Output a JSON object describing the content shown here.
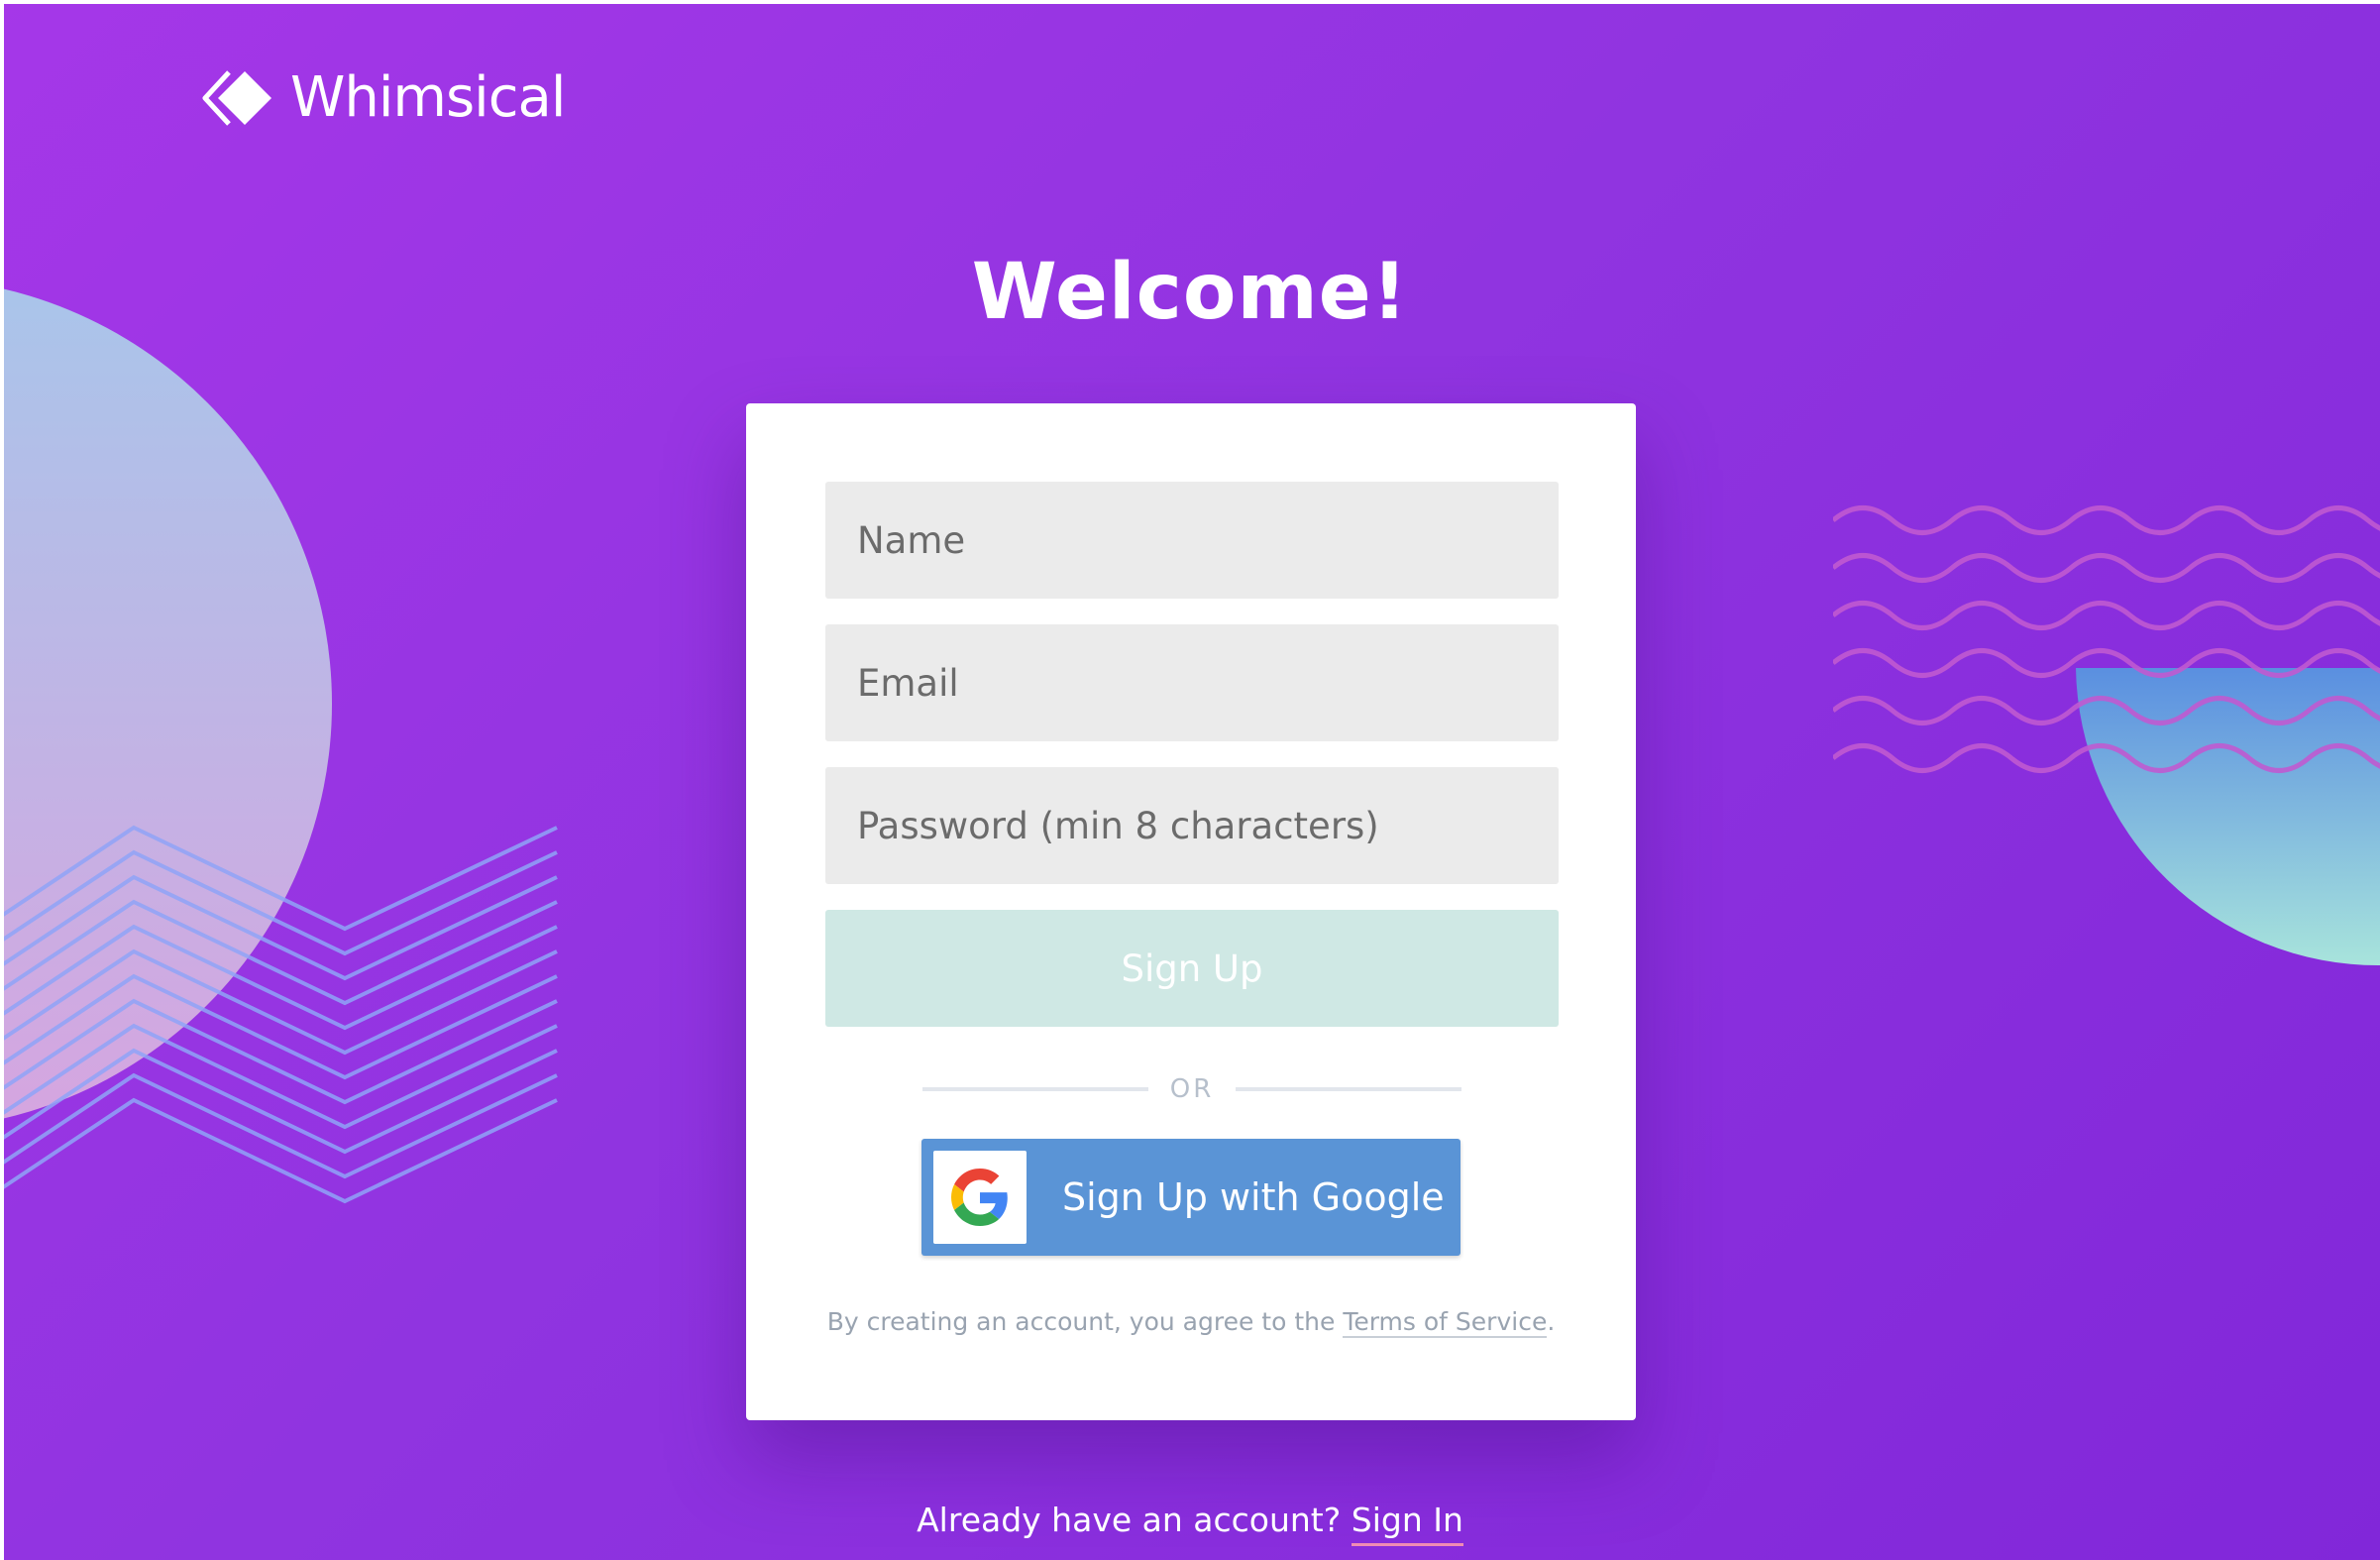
{
  "brand": {
    "name": "Whimsical",
    "logo_icon": "whimsical-diamond-logo-icon"
  },
  "heading": "Welcome!",
  "form": {
    "name_placeholder": "Name",
    "email_placeholder": "Email",
    "password_placeholder": "Password (min 8 characters)",
    "signup_label": "Sign Up",
    "or_label": "OR",
    "google_label": "Sign Up with Google",
    "google_icon": "google-g-icon"
  },
  "terms": {
    "prefix": "By creating an account, you agree to the ",
    "link_text": "Terms of Service",
    "suffix": "."
  },
  "footer": {
    "question": "Already have an account? ",
    "signin_link": "Sign In"
  },
  "colors": {
    "background_start": "#a537e8",
    "background_end": "#8127d9",
    "signup_button": "#cfe8e4",
    "google_button": "#5a94d6",
    "input_background": "#ebebeb"
  }
}
